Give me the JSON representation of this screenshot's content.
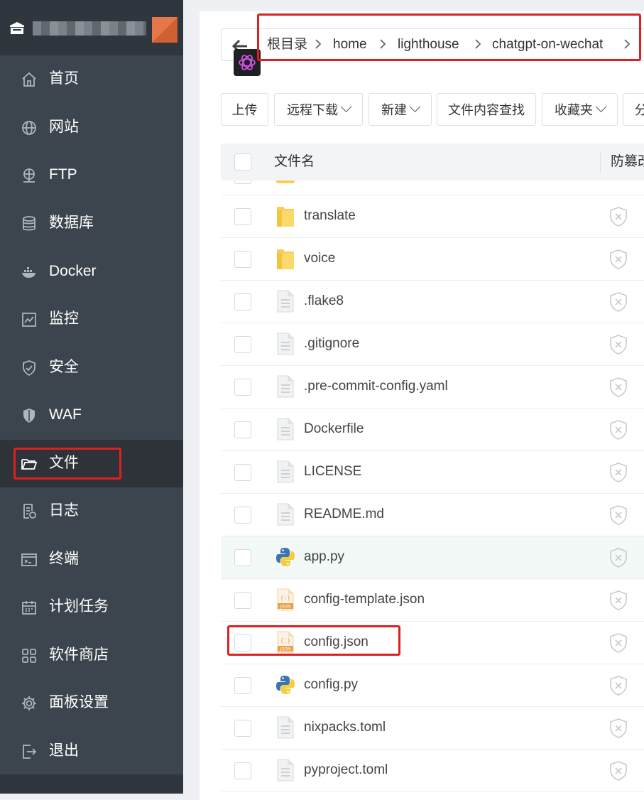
{
  "sidebar": {
    "items": [
      {
        "label": "首页",
        "icon": "home-icon"
      },
      {
        "label": "网站",
        "icon": "globe-icon"
      },
      {
        "label": "FTP",
        "icon": "ftp-icon"
      },
      {
        "label": "数据库",
        "icon": "database-icon"
      },
      {
        "label": "Docker",
        "icon": "docker-icon"
      },
      {
        "label": "监控",
        "icon": "monitor-icon"
      },
      {
        "label": "安全",
        "icon": "shield-icon"
      },
      {
        "label": "WAF",
        "icon": "waf-icon"
      },
      {
        "label": "文件",
        "icon": "folder-icon",
        "active": true
      },
      {
        "label": "日志",
        "icon": "log-icon"
      },
      {
        "label": "终端",
        "icon": "terminal-icon"
      },
      {
        "label": "计划任务",
        "icon": "calendar-icon"
      },
      {
        "label": "软件商店",
        "icon": "apps-icon"
      },
      {
        "label": "面板设置",
        "icon": "gear-icon"
      },
      {
        "label": "退出",
        "icon": "logout-icon"
      }
    ]
  },
  "breadcrumb": [
    "根目录",
    "home",
    "lighthouse",
    "chatgpt-on-wechat"
  ],
  "toolbar": {
    "upload": "上传",
    "remote_download": "远程下载",
    "new": "新建",
    "search_content": "文件内容查找",
    "favorites": "收藏夹",
    "share": "分"
  },
  "table": {
    "col_name": "文件名",
    "col_protect": "防篡改"
  },
  "files": [
    {
      "name": "translate",
      "type": "folder"
    },
    {
      "name": "voice",
      "type": "folder"
    },
    {
      "name": ".flake8",
      "type": "file"
    },
    {
      "name": ".gitignore",
      "type": "file"
    },
    {
      "name": ".pre-commit-config.yaml",
      "type": "file"
    },
    {
      "name": "Dockerfile",
      "type": "file"
    },
    {
      "name": "LICENSE",
      "type": "file"
    },
    {
      "name": "README.md",
      "type": "file"
    },
    {
      "name": "app.py",
      "type": "python",
      "highlighted": true
    },
    {
      "name": "config-template.json",
      "type": "json"
    },
    {
      "name": "config.json",
      "type": "json"
    },
    {
      "name": "config.py",
      "type": "python"
    },
    {
      "name": "nixpacks.toml",
      "type": "file"
    },
    {
      "name": "pyproject.toml",
      "type": "file"
    }
  ],
  "colors": {
    "sidebar_bg": "#3c444d",
    "sidebar_active_bg": "#2d3339",
    "highlight_box": "#e02020",
    "row_highlight": "#f2f9f7"
  }
}
